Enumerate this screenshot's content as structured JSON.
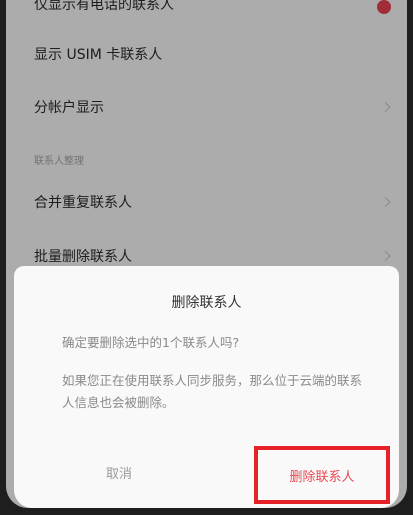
{
  "settings": {
    "row_top_partial": "仅显示有电话的联系人",
    "show_usim": "显示 USIM 卡联系人",
    "show_by_account": "分帐户显示",
    "section_header": "联系人整理",
    "merge_duplicates": "合并重复联系人",
    "batch_delete": "批量删除联系人"
  },
  "dialog": {
    "title": "删除联系人",
    "message_confirm": "确定要删除选中的1个联系人吗?",
    "message_sync": "如果您正在使用联系人同步服务，那么位于云端的联系人信息也会被删除。",
    "cancel_label": "取消",
    "delete_label": "删除联系人"
  },
  "colors": {
    "accent_red": "#e84a54",
    "highlight_box": "#e62229"
  }
}
